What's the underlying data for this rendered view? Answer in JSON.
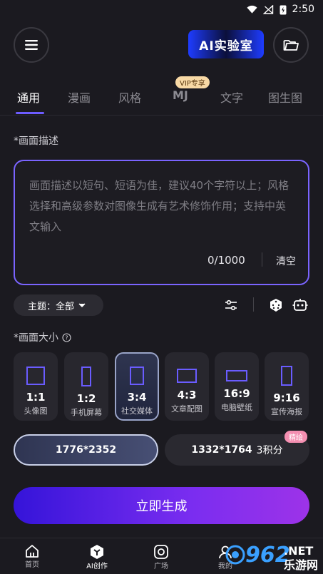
{
  "status": {
    "time": "2:50"
  },
  "header": {
    "logo_text": "AI实验室"
  },
  "tabs": [
    {
      "label": "通用"
    },
    {
      "label": "漫画"
    },
    {
      "label": "风格"
    },
    {
      "label": "MJ"
    },
    {
      "label": "文字"
    },
    {
      "label": "图生图"
    }
  ],
  "vip_badge": "VIP专享",
  "prompt": {
    "label": "*画面描述",
    "placeholder": "画面描述以短句、短语为佳，建议40个字符以上；风格选择和高级参数对图像生成有艺术修饰作用；支持中英文输入",
    "counter": "0/1000",
    "clear_label": "清空"
  },
  "theme": {
    "label": "主题：全部"
  },
  "size": {
    "label": "*画面大小",
    "ratios": [
      {
        "value": "1:1",
        "name": "头像图"
      },
      {
        "value": "1:2",
        "name": "手机屏幕"
      },
      {
        "value": "3:4",
        "name": "社交媒体"
      },
      {
        "value": "4:3",
        "name": "文章配图"
      },
      {
        "value": "16:9",
        "name": "电脑壁纸"
      },
      {
        "value": "9:16",
        "name": "宣传海报"
      }
    ],
    "selected_index": 2
  },
  "resolution": {
    "option1": "1776*2352",
    "option2": "1332*1764",
    "option2_cost": "3积分",
    "option2_badge": "精绘"
  },
  "generate_label": "立即生成",
  "nav": [
    {
      "label": "首页"
    },
    {
      "label": "AI创作"
    },
    {
      "label": "广场"
    },
    {
      "label": "我的"
    }
  ],
  "watermark": {
    "text": "962",
    "sub": "乐游网",
    "net": ".NET"
  },
  "colors": {
    "accent": "#6d5cff",
    "button_start": "#3514d9",
    "button_end": "#9d33e8"
  }
}
